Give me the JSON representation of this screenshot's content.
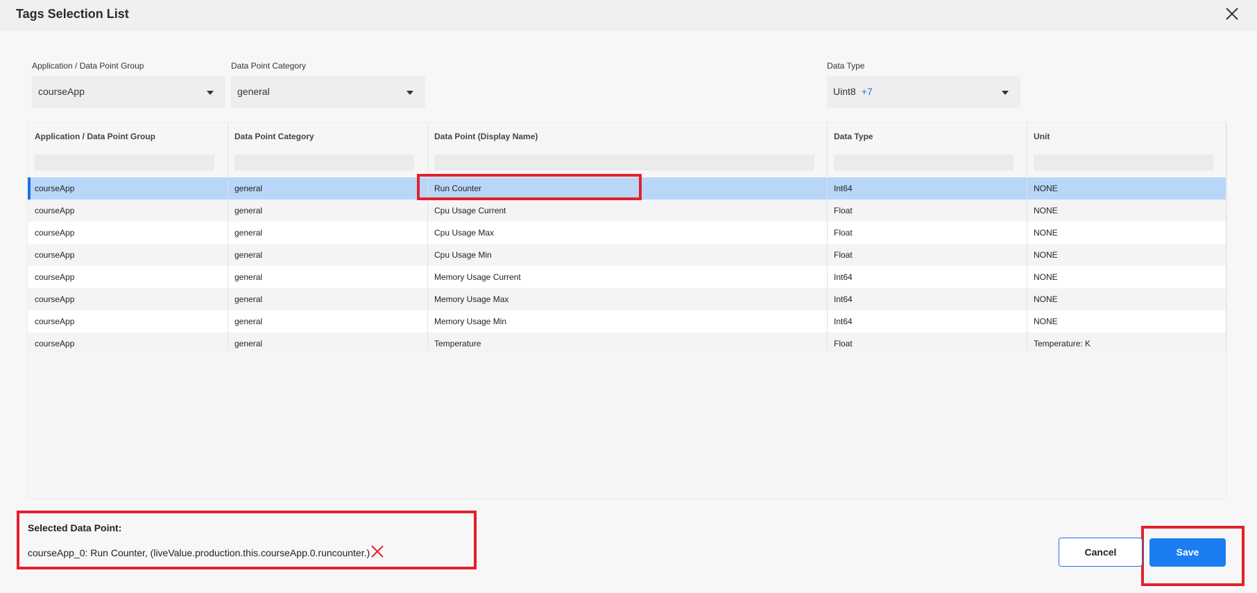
{
  "dialog": {
    "title": "Tags Selection List",
    "close_icon": "close-icon"
  },
  "filters": {
    "group": {
      "label": "Application / Data Point Group",
      "value": "courseApp"
    },
    "category": {
      "label": "Data Point Category",
      "value": "general"
    },
    "data_type": {
      "label": "Data Type",
      "value": "Uint8",
      "extra": "+7"
    }
  },
  "table": {
    "columns": [
      "Application / Data Point Group",
      "Data Point Category",
      "Data Point (Display Name)",
      "Data Type",
      "Unit"
    ],
    "rows": [
      [
        "courseApp",
        "general",
        "Run Counter",
        "Int64",
        "NONE"
      ],
      [
        "courseApp",
        "general",
        "Cpu Usage Current",
        "Float",
        "NONE"
      ],
      [
        "courseApp",
        "general",
        "Cpu Usage Max",
        "Float",
        "NONE"
      ],
      [
        "courseApp",
        "general",
        "Cpu Usage Min",
        "Float",
        "NONE"
      ],
      [
        "courseApp",
        "general",
        "Memory Usage Current",
        "Int64",
        "NONE"
      ],
      [
        "courseApp",
        "general",
        "Memory Usage Max",
        "Int64",
        "NONE"
      ],
      [
        "courseApp",
        "general",
        "Memory Usage Min",
        "Int64",
        "NONE"
      ],
      [
        "courseApp",
        "general",
        "Temperature",
        "Float",
        "Temperature: K"
      ]
    ],
    "selected_row": 0
  },
  "selection": {
    "title": "Selected Data Point:",
    "text": "courseApp_0: Run Counter, (liveValue.production.this.courseApp.0.runcounter.)",
    "remove_icon": "remove-icon"
  },
  "buttons": {
    "cancel": "Cancel",
    "save": "Save"
  },
  "colors": {
    "accent": "#1a73e8",
    "selected_row": "#b8d6f7",
    "highlight": "#e3202b"
  }
}
